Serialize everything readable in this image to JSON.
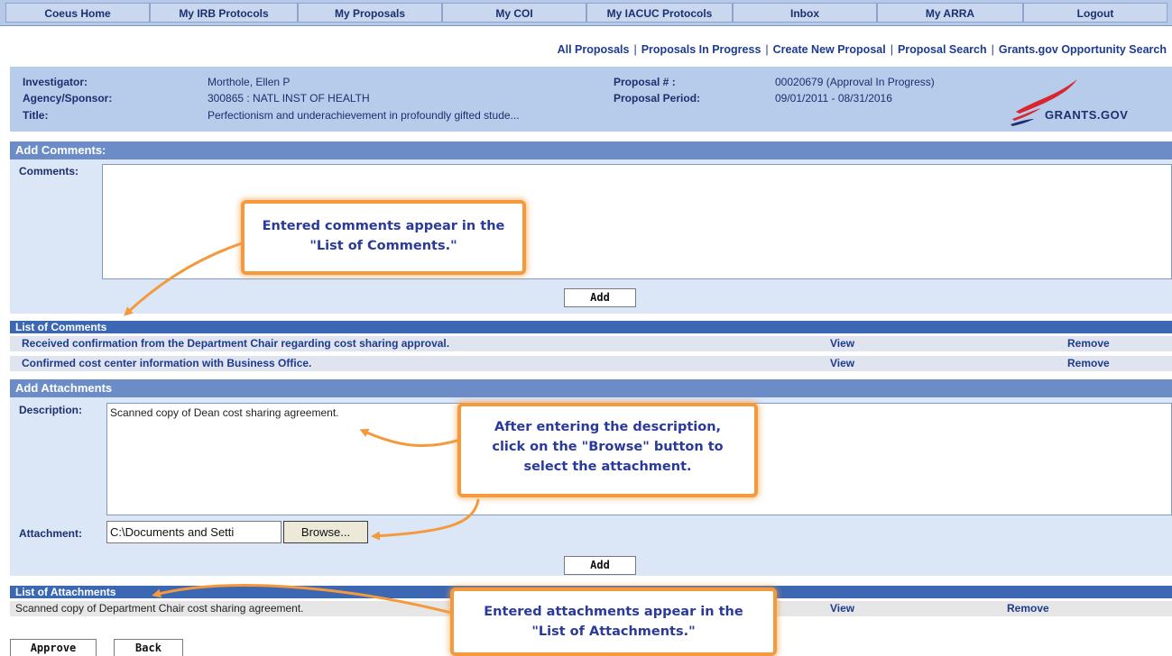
{
  "nav": {
    "items": [
      "Coeus Home",
      "My IRB Protocols",
      "My Proposals",
      "My COI",
      "My IACUC Protocols",
      "Inbox",
      "My ARRA",
      "Logout"
    ]
  },
  "subnav": {
    "links": [
      "All Proposals",
      "Proposals In Progress",
      "Create New Proposal",
      "Proposal Search",
      "Grants.gov Opportunity Search"
    ]
  },
  "header": {
    "investigator_label": "Investigator:",
    "investigator_value": "Morthole, Ellen P",
    "agency_label": "Agency/Sponsor:",
    "agency_value": "300865 : NATL INST OF HEALTH",
    "title_label": "Title:",
    "title_value": "Perfectionism and underachievement in profoundly gifted stude...",
    "proposal_label": "Proposal # :",
    "proposal_value": "00020679 (Approval In Progress)",
    "period_label": "Proposal Period:",
    "period_value": "09/01/2011 - 08/31/2016",
    "logo_text": "GRANTS.GOV"
  },
  "comments": {
    "section_title": "Add Comments:",
    "label": "Comments:",
    "value": "",
    "add_label": "Add",
    "list_title": "List of Comments",
    "items": [
      {
        "text": "Received confirmation from the Department Chair regarding cost sharing approval.",
        "view": "View",
        "remove": "Remove"
      },
      {
        "text": "Confirmed cost center information with Business Office.",
        "view": "View",
        "remove": "Remove"
      }
    ]
  },
  "attachments": {
    "section_title": "Add Attachments",
    "description_label": "Description:",
    "description_value": "Scanned copy of Dean cost sharing agreement.",
    "attachment_label": "Attachment:",
    "attachment_value": "C:\\Documents and Setti",
    "browse_label": "Browse...",
    "add_label": "Add",
    "list_title": "List of Attachments",
    "items": [
      {
        "text": "Scanned copy of Department Chair cost sharing agreement.",
        "view": "View",
        "remove": "Remove"
      }
    ]
  },
  "footer": {
    "approve_label": "Approve",
    "back_label": "Back"
  },
  "callouts": {
    "comments_note": "Entered comments appear in the \"List of Comments.\"",
    "browse_note": "After entering the description, click on the \"Browse\" button to select the attachment.",
    "attachments_note": "Entered attachments appear in the \"List of Attachments.\""
  },
  "colors": {
    "nav_bg": "#b7c9e8",
    "section_bg": "#6b8cc7",
    "list_header_bg": "#3c67b3",
    "callout_border": "#f49a3c",
    "logo_red": "#d8262e"
  }
}
